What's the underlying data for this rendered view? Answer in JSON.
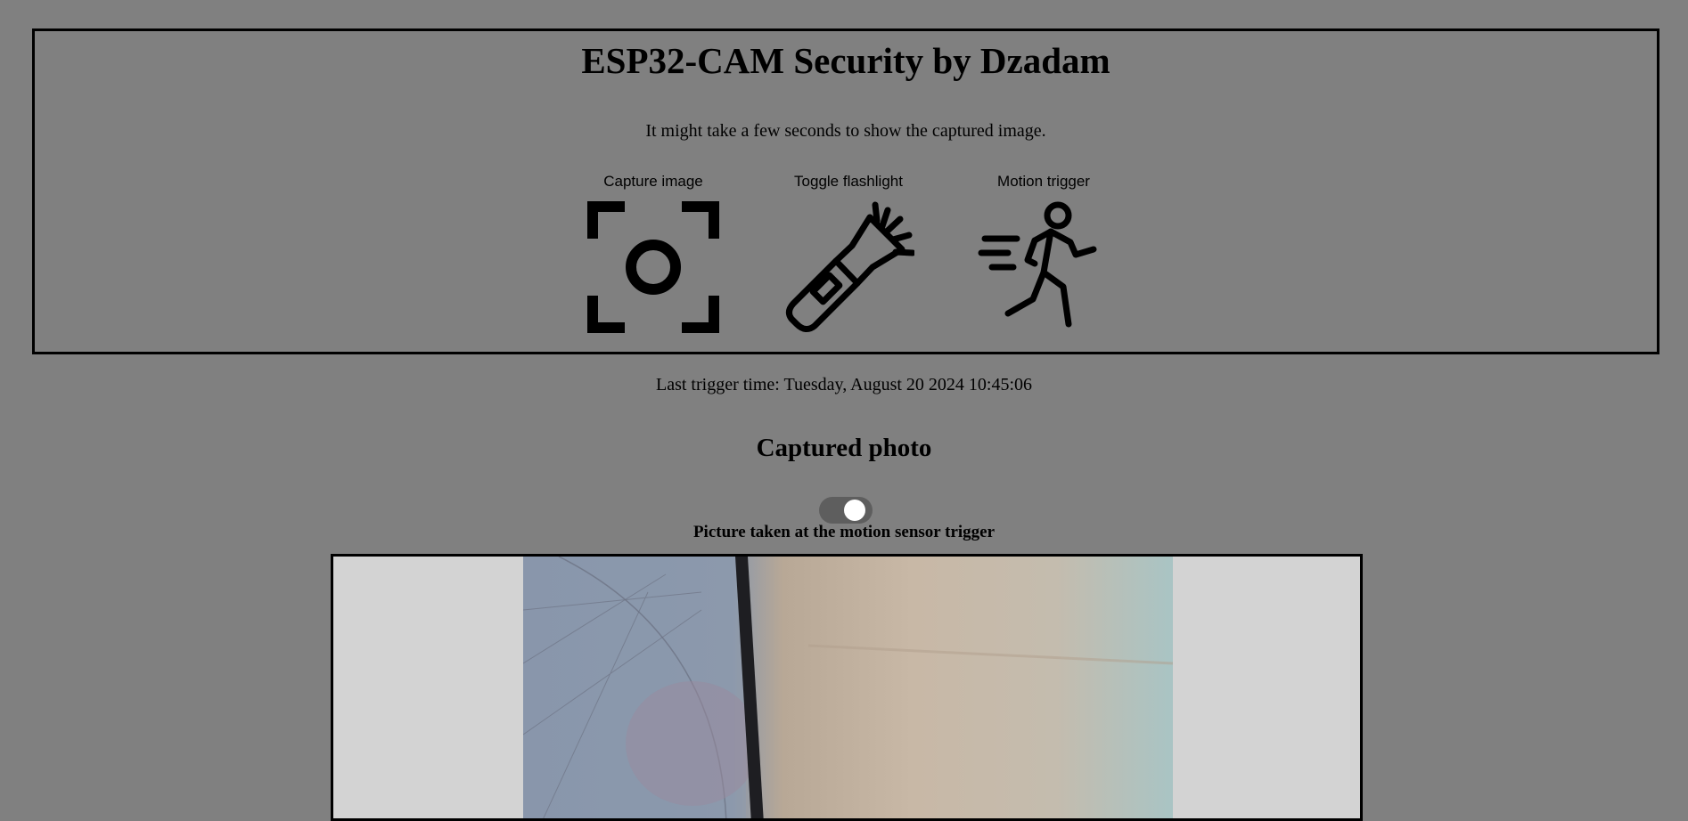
{
  "header": {
    "title": "ESP32-CAM Security by Dzadam",
    "subtitle": "It might take a few seconds to show the captured image."
  },
  "actions": [
    {
      "label": "Capture image",
      "icon": "camera-focus-icon"
    },
    {
      "label": "Toggle flashlight",
      "icon": "flashlight-icon"
    },
    {
      "label": "Motion trigger",
      "icon": "running-person-icon"
    }
  ],
  "status": {
    "last_trigger": "Last trigger time: Tuesday, August 20 2024 10:45:06"
  },
  "photo_section": {
    "title": "Captured photo",
    "toggle_on": true,
    "caption": "Picture taken at the motion sensor trigger"
  },
  "colors": {
    "background": "#808080",
    "frame_background": "#d3d3d3",
    "toggle_track": "#5e5e5e"
  }
}
